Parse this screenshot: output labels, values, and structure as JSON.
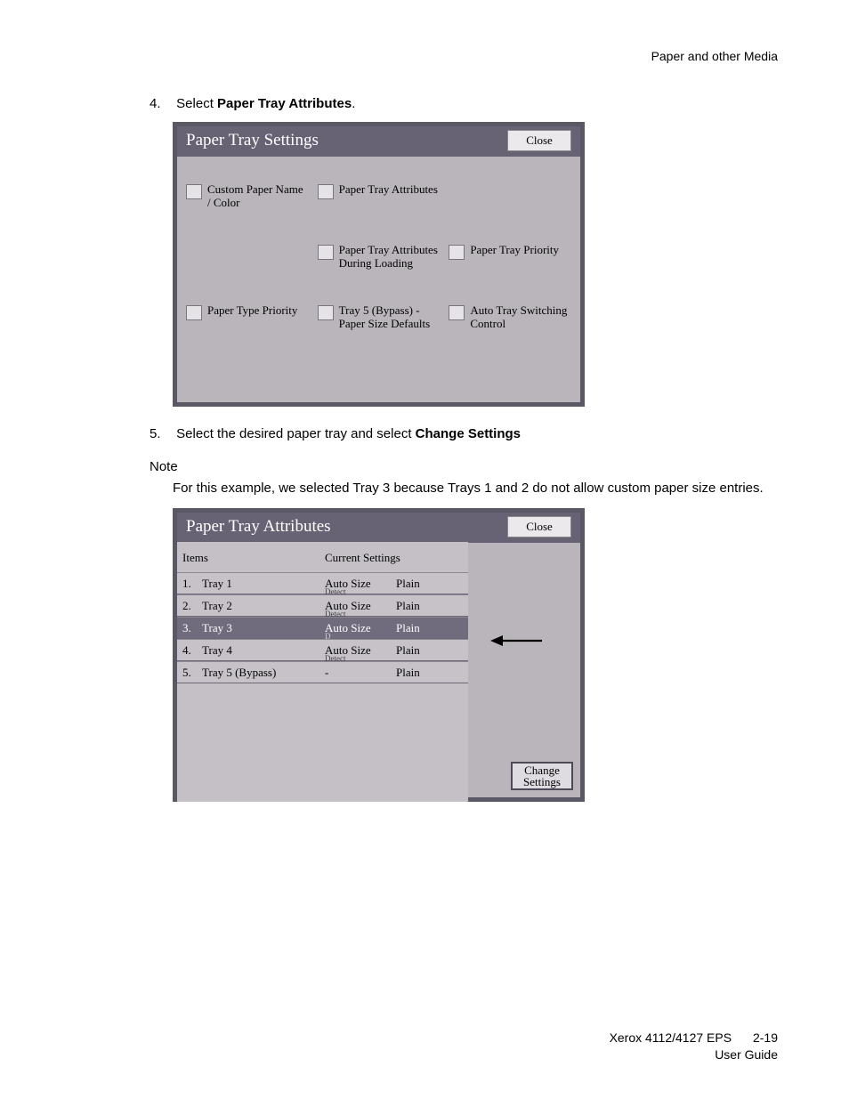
{
  "header": {
    "section_title": "Paper and other Media"
  },
  "step4": {
    "number": "4.",
    "text_pre": "Select ",
    "text_bold": "Paper Tray Attributes",
    "text_post": "."
  },
  "panel1": {
    "title": "Paper Tray Settings",
    "close_label": "Close",
    "options": [
      "Custom Paper Name / Color",
      "Paper Tray Attributes",
      "",
      "",
      "Paper Tray Attributes During Loading",
      "Paper Tray Priority",
      "Paper Type Priority",
      "Tray 5 (Bypass) - Paper Size Defaults",
      "Auto Tray Switching Control"
    ]
  },
  "step5": {
    "number": "5.",
    "text_pre": "Select the desired paper tray and select ",
    "text_bold": "Change Settings"
  },
  "note": {
    "label": "Note",
    "body": "For this example, we selected Tray 3 because Trays 1 and 2 do not allow custom paper size entries."
  },
  "panel2": {
    "title": "Paper Tray Attributes",
    "close_label": "Close",
    "header_items": "Items",
    "header_settings": "Current Settings",
    "rows": [
      {
        "num": "1.",
        "name": "Tray 1",
        "size": "Auto Size",
        "detect": "Detect",
        "type": "Plain",
        "selected": false
      },
      {
        "num": "2.",
        "name": "Tray 2",
        "size": "Auto Size",
        "detect": "Detect",
        "type": "Plain",
        "selected": false
      },
      {
        "num": "3.",
        "name": "Tray 3",
        "size": "Auto Size",
        "detect": "D",
        "type": "Plain",
        "selected": true
      },
      {
        "num": "4.",
        "name": "Tray 4",
        "size": "Auto Size",
        "detect": "Detect",
        "type": "Plain",
        "selected": false
      },
      {
        "num": "5.",
        "name": "Tray 5 (Bypass)",
        "size": "-",
        "detect": "",
        "type": "Plain",
        "selected": false
      }
    ],
    "change_label": "Change Settings"
  },
  "footer": {
    "line1_left": "Xerox 4112/4127 EPS",
    "pagenum": "2-19",
    "line2": "User Guide"
  }
}
